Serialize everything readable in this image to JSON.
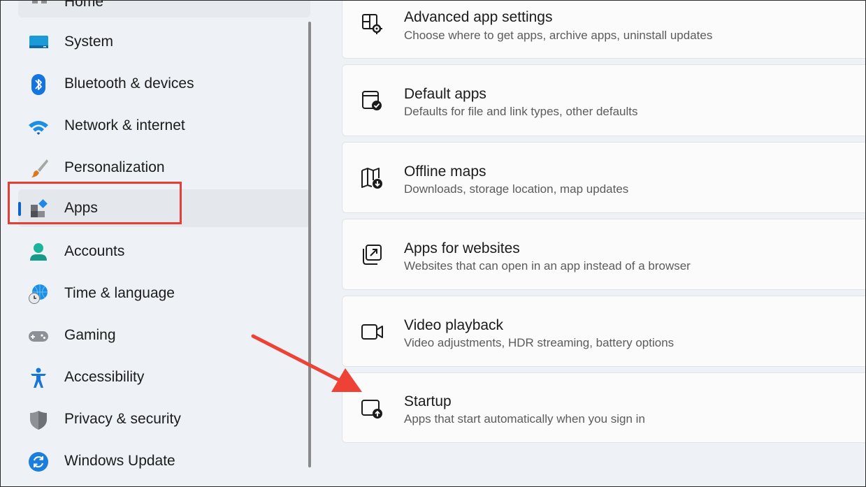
{
  "sidebar": {
    "home_label": "Home",
    "items": [
      {
        "label": "System",
        "icon": "system-icon"
      },
      {
        "label": "Bluetooth & devices",
        "icon": "bluetooth-icon"
      },
      {
        "label": "Network & internet",
        "icon": "wifi-icon"
      },
      {
        "label": "Personalization",
        "icon": "paintbrush-icon"
      },
      {
        "label": "Apps",
        "icon": "apps-icon",
        "selected": true
      },
      {
        "label": "Accounts",
        "icon": "account-icon"
      },
      {
        "label": "Time & language",
        "icon": "globe-clock-icon"
      },
      {
        "label": "Gaming",
        "icon": "gamepad-icon"
      },
      {
        "label": "Accessibility",
        "icon": "accessibility-icon"
      },
      {
        "label": "Privacy & security",
        "icon": "shield-icon"
      },
      {
        "label": "Windows Update",
        "icon": "update-icon"
      }
    ]
  },
  "main": {
    "cards": [
      {
        "title": "Advanced app settings",
        "desc": "Choose where to get apps, archive apps, uninstall updates",
        "icon": "advanced-app-settings-icon"
      },
      {
        "title": "Default apps",
        "desc": "Defaults for file and link types, other defaults",
        "icon": "default-apps-icon"
      },
      {
        "title": "Offline maps",
        "desc": "Downloads, storage location, map updates",
        "icon": "offline-maps-icon"
      },
      {
        "title": "Apps for websites",
        "desc": "Websites that can open in an app instead of a browser",
        "icon": "apps-for-websites-icon"
      },
      {
        "title": "Video playback",
        "desc": "Video adjustments, HDR streaming, battery options",
        "icon": "video-playback-icon"
      },
      {
        "title": "Startup",
        "desc": "Apps that start automatically when you sign in",
        "icon": "startup-icon"
      }
    ]
  },
  "colors": {
    "accent": "#0f62c9",
    "annotation": "#e53f35",
    "sidebar_bg": "#eef2f7",
    "card_bg": "#fbfbfc"
  }
}
